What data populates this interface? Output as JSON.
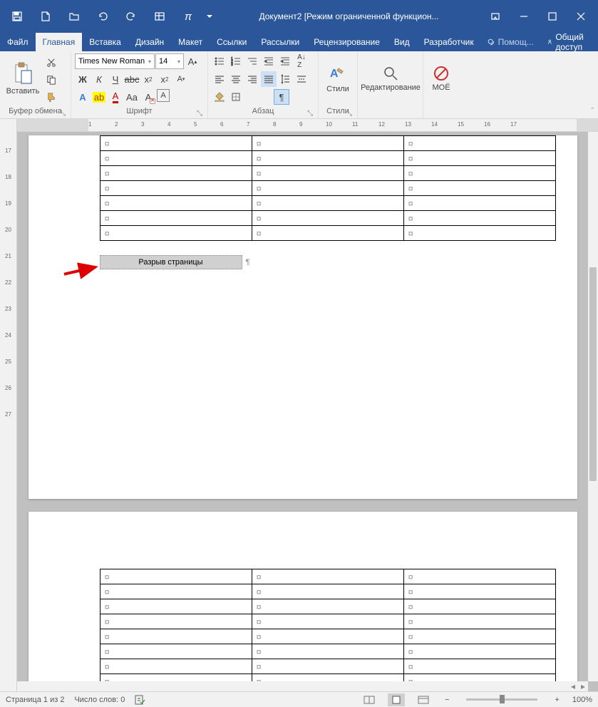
{
  "title": "Документ2 [Режим ограниченной функцион...",
  "tabs": {
    "file": "Файл",
    "home": "Главная",
    "insert": "Вставка",
    "design": "Дизайн",
    "layout": "Макет",
    "references": "Ссылки",
    "mailings": "Рассылки",
    "review": "Рецензирование",
    "view": "Вид",
    "developer": "Разработчик"
  },
  "tellme": "Помощ...",
  "share": "Общий доступ",
  "ribbon": {
    "clipboard": {
      "label": "Буфер обмена",
      "paste": "Вставить"
    },
    "font": {
      "label": "Шрифт",
      "name": "Times New Roman",
      "size": "14",
      "bold": "Ж",
      "italic": "К",
      "underline": "Ч"
    },
    "paragraph": {
      "label": "Абзац"
    },
    "styles": {
      "label": "Стили",
      "button": "Стили"
    },
    "editing": {
      "button": "Редактирование"
    },
    "moe": {
      "button": "МОЁ"
    }
  },
  "document": {
    "page_break": "Разрыв страницы",
    "table_rows_page1": 7,
    "table_rows_page2": 8,
    "table_cols": 3
  },
  "ruler_h": [
    "1",
    "2",
    "3",
    "4",
    "5",
    "6",
    "7",
    "8",
    "9",
    "10",
    "11",
    "12",
    "13",
    "14",
    "15",
    "16",
    "17"
  ],
  "ruler_v": [
    "17",
    "18",
    "19",
    "20",
    "21",
    "22",
    "23",
    "24",
    "25",
    "26",
    "27"
  ],
  "status": {
    "page": "Страница 1 из 2",
    "words": "Число слов: 0",
    "zoom": "100%"
  }
}
